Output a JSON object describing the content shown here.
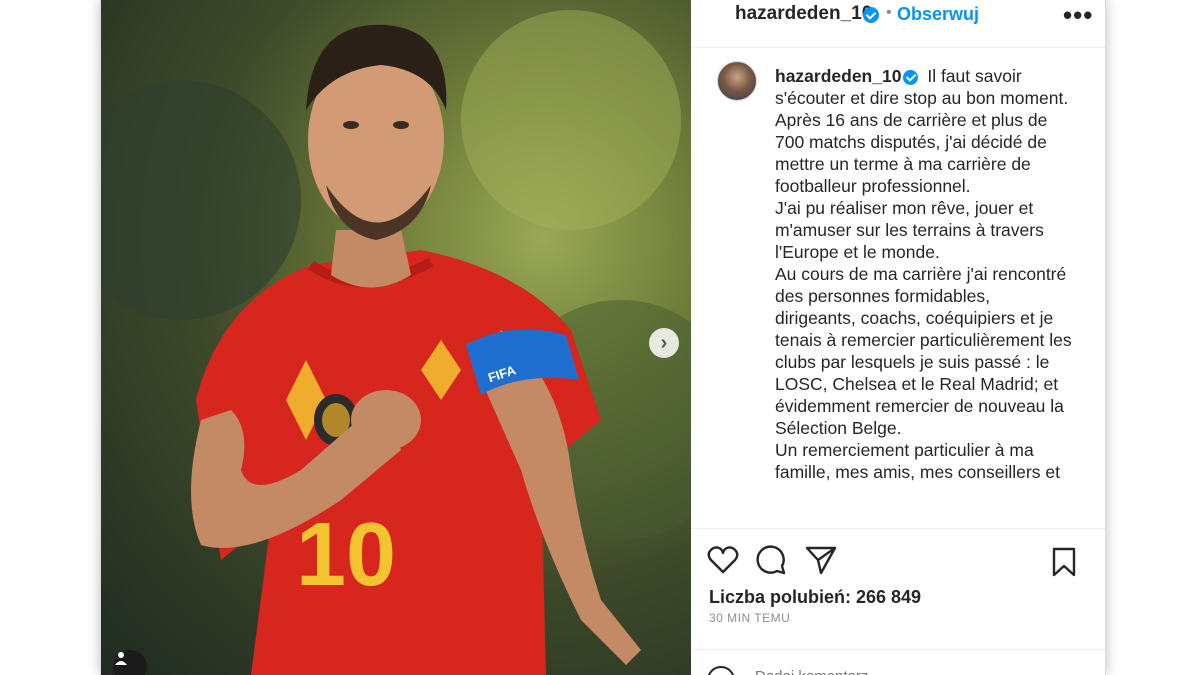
{
  "post": {
    "username": "hazardeden_10",
    "dot": "•",
    "follow_label": "Obserwuj",
    "more_label": "•••",
    "next_label": "›"
  },
  "caption": {
    "username": "hazardeden_10",
    "lines": [
      "Il faut savoir s'écouter et dire stop au bon moment.",
      "Après 16 ans de carrière et plus de 700 matchs disputés, j'ai décidé de mettre un terme à ma carrière de footballeur professionnel.",
      "J'ai pu réaliser mon rêve, jouer et m'amuser sur les terrains à travers l'Europe et le monde.",
      "Au cours de ma carrière j'ai rencontré des personnes formidables, dirigeants, coachs, coéquipiers et je tenais à remercier particulièrement les clubs par lesquels je suis passé : le LOSC, Chelsea et le Real Madrid; et évidemment remercier de nouveau la Sélection Belge.",
      "Un remerciement particulier à ma famille, mes amis, mes conseillers et"
    ]
  },
  "footer": {
    "likes_label": "Liczba polubień: 266 849",
    "time_label": "30 MIN TEMU",
    "comment_placeholder": "Dodaj komentarz..."
  },
  "colors": {
    "accent": "#0095f6",
    "jersey_red": "#d7261e",
    "text": "#262626",
    "muted": "#8e8e8e"
  },
  "icons": [
    "verified-icon",
    "more-icon",
    "heart-icon",
    "comment-icon",
    "share-icon",
    "bookmark-icon",
    "chevron-right-icon",
    "user-tag-icon",
    "emoji-icon"
  ]
}
